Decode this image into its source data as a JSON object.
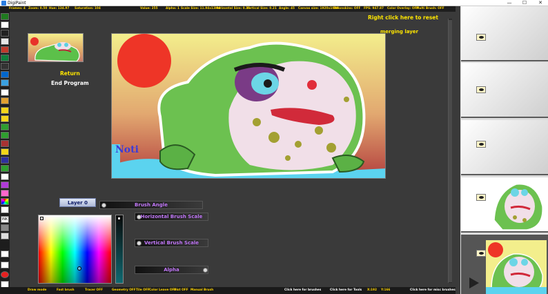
{
  "window": {
    "title": "DigiPaint",
    "minimize": "—",
    "maximize": "☐",
    "close": "✕"
  },
  "status_top": [
    {
      "text": "Frames: 4"
    },
    {
      "text": "Zoom: 0.50"
    },
    {
      "text": "Hue: 134.97"
    },
    {
      "text": "Saturation: 104"
    },
    {
      "text": "Value: 255"
    },
    {
      "text": "Alpha: 1"
    },
    {
      "text": "Scale Size: 11.94x13.94"
    },
    {
      "text": "Horizontal Size: 0.21"
    },
    {
      "text": "Vertical Size: 0.21"
    },
    {
      "text": "Angle: 45"
    },
    {
      "text": "Canvas size: 1920x1080"
    },
    {
      "text": "Onionskins: OFF"
    },
    {
      "text": "FPS: 947.87"
    },
    {
      "text": "Color Overlay: OFF"
    },
    {
      "text": "Multi Brush: OFF"
    }
  ],
  "hints": {
    "reset": "Right click here to reset",
    "merge": "merging layer"
  },
  "menu": {
    "return_label": "Return",
    "end_label": "End Program"
  },
  "layer_button": "Layer 0",
  "sliders": {
    "brush_angle": "Brush Angle",
    "horizontal_scale": "Horizontal Brush Scale",
    "vertical_scale": "Vertical Brush Scale",
    "alpha": "Alpha"
  },
  "canvas_signature": "Noti",
  "status_bottom": [
    {
      "text": "Draw mode"
    },
    {
      "text": "Fast brush"
    },
    {
      "text": "Tracer OFF"
    },
    {
      "text": "Geometry OFF"
    },
    {
      "text": "Tile OFF"
    },
    {
      "text": "Color Leave OFF"
    },
    {
      "text": "Dist OFF"
    },
    {
      "text": "Manual Brush"
    },
    {
      "text": "Click here for brushes"
    },
    {
      "text": "Click here for Tools"
    },
    {
      "text": "X:192"
    },
    {
      "text": "Y:166"
    },
    {
      "text": "Click here for misc brushes"
    }
  ],
  "colors": {
    "accent": "#ffe600",
    "slider_label": "#c77dff",
    "background": "#3a3a3a"
  },
  "tools": [
    "pencil-icon",
    "eraser-icon",
    "fill-icon",
    "line-icon",
    "brush-icon",
    "text-icon",
    "shape-icon",
    "picker-icon",
    "select-icon",
    "layer-icon",
    "color-icon",
    "save-icon"
  ]
}
